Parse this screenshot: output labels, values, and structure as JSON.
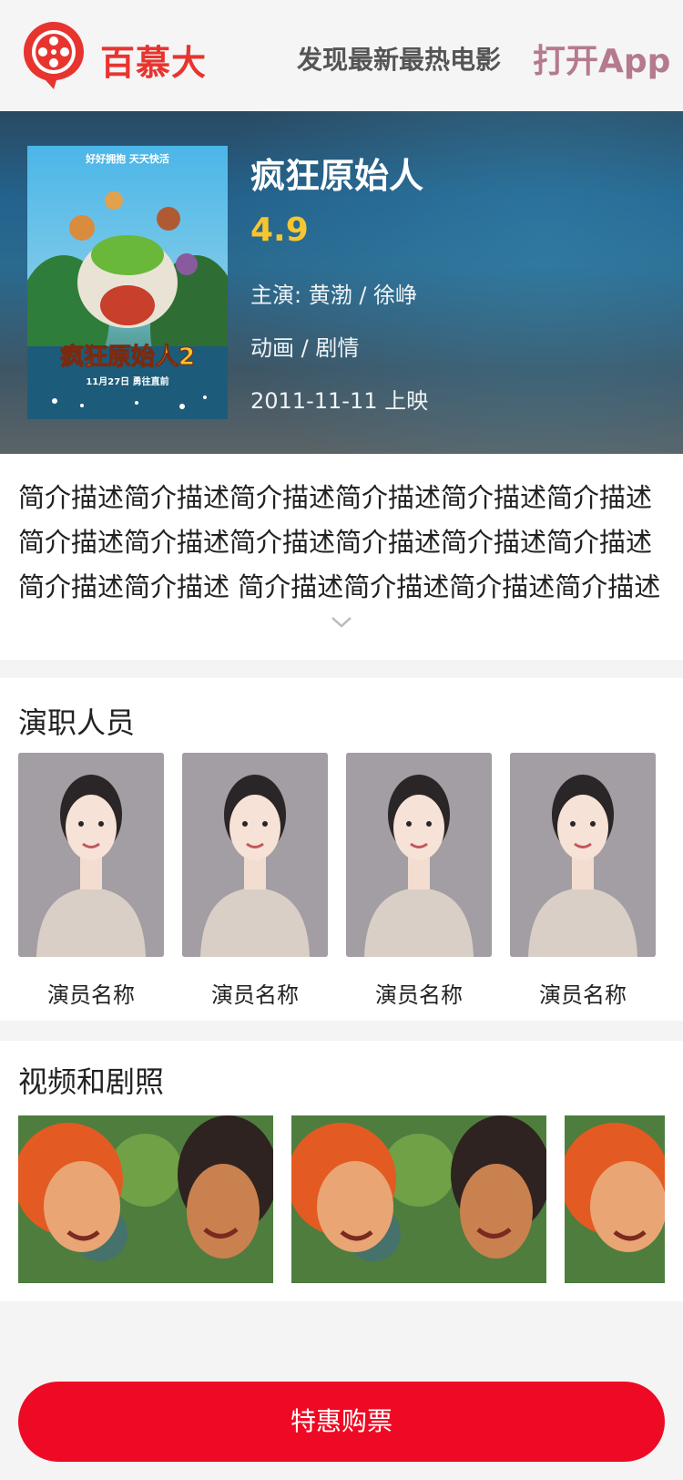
{
  "header": {
    "brand": "百慕大",
    "slogan": "发现最新最热电影",
    "open_app": "打开App"
  },
  "movie": {
    "title": "疯狂原始人",
    "rating": "4.9",
    "cast": "主演: 黄渤 / 徐峥",
    "genre": "动画 / 剧情",
    "release": "2011-11-11 上映",
    "poster": {
      "top_text": "好好拥抱 天天快活",
      "title_text": "疯狂原始人2",
      "date_text": "11月27日 勇往直前"
    }
  },
  "synopsis": {
    "text": "简介描述简介描述简介描述简介描述简介描述简介描述简介描述简介描述简介描述简介描述简介描述简介描述简介描述简介描述 简介描述简介描述简介描述简介描述"
  },
  "cast_section": {
    "title": "演职人员",
    "actors": [
      {
        "name": "演员名称"
      },
      {
        "name": "演员名称"
      },
      {
        "name": "演员名称"
      },
      {
        "name": "演员名称"
      }
    ]
  },
  "media_section": {
    "title": "视频和剧照"
  },
  "buy_button": {
    "label": "特惠购票"
  },
  "colors": {
    "brand_red": "#e8342f",
    "button_red": "#ee0a24",
    "rating_yellow": "#f7c62f"
  }
}
